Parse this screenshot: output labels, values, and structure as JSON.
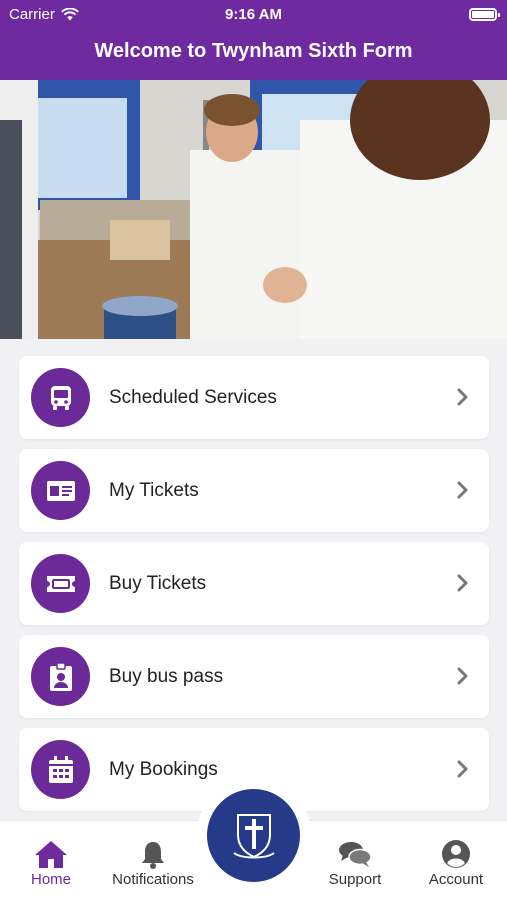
{
  "status_bar": {
    "carrier": "Carrier",
    "time": "9:16 AM"
  },
  "header": {
    "title": "Welcome to Twynham Sixth Form"
  },
  "menu": {
    "items": [
      {
        "label": "Scheduled Services",
        "icon": "bus-icon"
      },
      {
        "label": "My Tickets",
        "icon": "id-card-icon"
      },
      {
        "label": "Buy Tickets",
        "icon": "ticket-icon"
      },
      {
        "label": "Buy bus pass",
        "icon": "badge-icon"
      },
      {
        "label": "My Bookings",
        "icon": "calendar-icon"
      }
    ]
  },
  "tabbar": {
    "home": "Home",
    "notifications": "Notifications",
    "support": "Support",
    "account": "Account"
  },
  "colors": {
    "header": "#6f2aa0",
    "icon_circle": "#6c2a98",
    "crest": "#263a8a"
  }
}
